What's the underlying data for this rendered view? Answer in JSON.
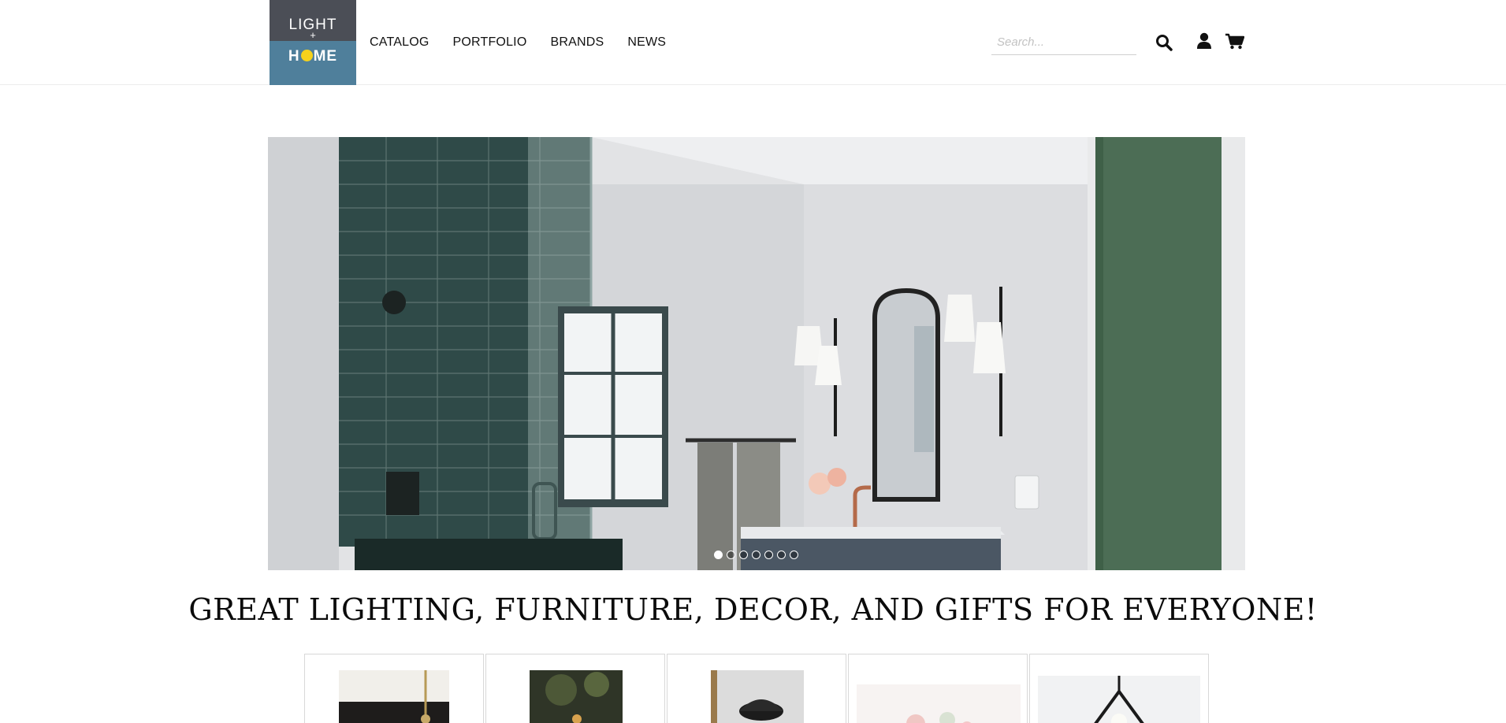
{
  "brand": {
    "logo_top": "LIGHT",
    "logo_plus": "+",
    "logo_home_left": "H",
    "logo_home_right": "ME"
  },
  "nav": {
    "items": [
      "CATALOG",
      "PORTFOLIO",
      "BRANDS",
      "NEWS"
    ]
  },
  "search": {
    "placeholder": "Search..."
  },
  "icons": {
    "search": "search-icon",
    "account": "user-icon",
    "cart": "cart-icon"
  },
  "hero": {
    "slide_count": 7,
    "active_slide": 1
  },
  "headline": "GREAT LIGHTING, FURNITURE, DECOR, AND GIFTS FOR EVERYONE!",
  "colors": {
    "logo_dark": "#4b4e56",
    "logo_blue": "#4f7f9b",
    "logo_accent": "#f5d21c"
  }
}
